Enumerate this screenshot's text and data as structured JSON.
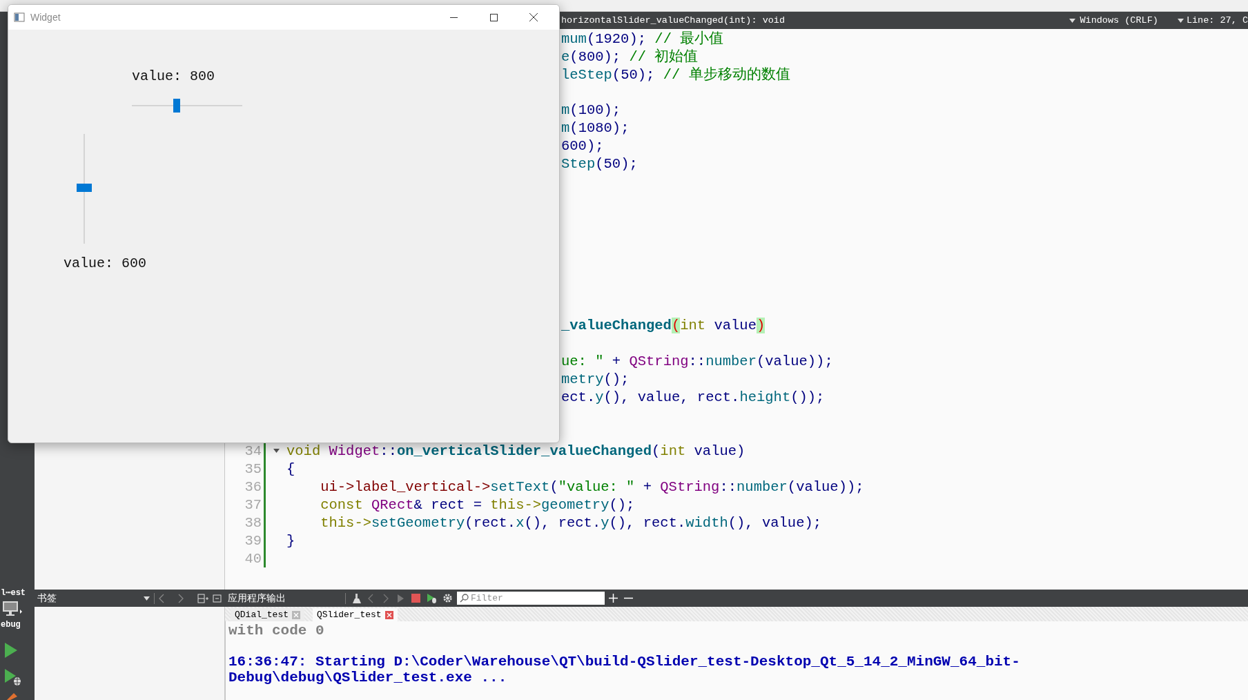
{
  "ide": {
    "mode_bar": {
      "project": "l⋯est",
      "build_config": "ebug"
    },
    "editor_toolbar": {
      "symbol": "horizontalSlider_valueChanged(int): void",
      "line_ending": "Windows (CRLF)",
      "position": "Line: 27, C"
    },
    "editor": {
      "lines": [
        {
          "kind": "partial",
          "tokens": [
            {
              "text": "mum",
              "kind": "fn"
            },
            {
              "text": "(",
              "kind": "plain"
            },
            {
              "text": "1920",
              "kind": "num"
            },
            {
              "text": "); ",
              "kind": "plain"
            },
            {
              "text": "// 最小值",
              "kind": "cmt"
            }
          ]
        },
        {
          "kind": "partial",
          "tokens": [
            {
              "text": "e",
              "kind": "fn"
            },
            {
              "text": "(",
              "kind": "plain"
            },
            {
              "text": "800",
              "kind": "num"
            },
            {
              "text": "); ",
              "kind": "plain"
            },
            {
              "text": "// 初始值",
              "kind": "cmt"
            }
          ]
        },
        {
          "kind": "partial",
          "tokens": [
            {
              "text": "leStep",
              "kind": "fn"
            },
            {
              "text": "(",
              "kind": "plain"
            },
            {
              "text": "50",
              "kind": "num"
            },
            {
              "text": "); ",
              "kind": "plain"
            },
            {
              "text": "// 单步移动的数值",
              "kind": "cmt"
            }
          ]
        },
        {
          "kind": "blank"
        },
        {
          "kind": "partial",
          "tokens": [
            {
              "text": "m",
              "kind": "fn"
            },
            {
              "text": "(",
              "kind": "plain"
            },
            {
              "text": "100",
              "kind": "num"
            },
            {
              "text": ");",
              "kind": "plain"
            }
          ]
        },
        {
          "kind": "partial",
          "tokens": [
            {
              "text": "m",
              "kind": "fn"
            },
            {
              "text": "(",
              "kind": "plain"
            },
            {
              "text": "1080",
              "kind": "num"
            },
            {
              "text": ");",
              "kind": "plain"
            }
          ]
        },
        {
          "kind": "partial",
          "tokens": [
            {
              "text": "600",
              "kind": "num"
            },
            {
              "text": ");",
              "kind": "plain"
            }
          ]
        },
        {
          "kind": "partial",
          "tokens": [
            {
              "text": "Step",
              "kind": "fn"
            },
            {
              "text": "(",
              "kind": "plain"
            },
            {
              "text": "50",
              "kind": "num"
            },
            {
              "text": ");",
              "kind": "plain"
            }
          ]
        },
        {
          "kind": "blank"
        },
        {
          "kind": "blank"
        },
        {
          "kind": "blank"
        },
        {
          "kind": "blank"
        },
        {
          "kind": "blank"
        },
        {
          "kind": "blank"
        },
        {
          "kind": "blank"
        },
        {
          "kind": "blank"
        },
        {
          "kind": "partial",
          "tokens": [
            {
              "text": "_valueChanged",
              "kind": "fnb"
            },
            {
              "text": "(",
              "kind": "match"
            },
            {
              "text": "int",
              "kind": "kw"
            },
            {
              "text": " value",
              "kind": "plain"
            },
            {
              "text": ")",
              "kind": "match"
            }
          ]
        },
        {
          "kind": "blank"
        },
        {
          "kind": "partial",
          "tokens": [
            {
              "text": "ue: ″",
              "kind": "str"
            },
            {
              "text": " + ",
              "kind": "plain"
            },
            {
              "text": "QString",
              "kind": "type"
            },
            {
              "text": "::",
              "kind": "plain"
            },
            {
              "text": "number",
              "kind": "fn"
            },
            {
              "text": "(value));",
              "kind": "plain"
            }
          ]
        },
        {
          "kind": "partial",
          "tokens": [
            {
              "text": "metry",
              "kind": "fn"
            },
            {
              "text": "();",
              "kind": "plain"
            }
          ]
        },
        {
          "kind": "partial",
          "tokens": [
            {
              "text": "ect.",
              "kind": "plain"
            },
            {
              "text": "y",
              "kind": "fn"
            },
            {
              "text": "(), value, rect.",
              "kind": "plain"
            },
            {
              "text": "height",
              "kind": "fn"
            },
            {
              "text": "());",
              "kind": "plain"
            }
          ]
        },
        {
          "kind": "blank"
        },
        {
          "kind": "blank"
        },
        {
          "kind": "code",
          "number": "34",
          "foldable": true,
          "tokens": [
            {
              "text": "void",
              "kind": "kw"
            },
            {
              "text": " Widget",
              "kind": "type"
            },
            {
              "text": "::",
              "kind": "plain"
            },
            {
              "text": "on_verticalSlider_valueChanged",
              "kind": "fnb"
            },
            {
              "text": "(",
              "kind": "plain"
            },
            {
              "text": "int",
              "kind": "kw"
            },
            {
              "text": " value)",
              "kind": "plain"
            }
          ]
        },
        {
          "kind": "code",
          "number": "35",
          "tokens": [
            {
              "text": "{",
              "kind": "plain"
            }
          ]
        },
        {
          "kind": "code",
          "number": "36",
          "tokens": [
            {
              "text": "    ui->label_vertical->",
              "kind": "member"
            },
            {
              "text": "setText",
              "kind": "fn"
            },
            {
              "text": "(",
              "kind": "plain"
            },
            {
              "text": "″value: ″",
              "kind": "str"
            },
            {
              "text": " + ",
              "kind": "plain"
            },
            {
              "text": "QString",
              "kind": "type"
            },
            {
              "text": "::",
              "kind": "plain"
            },
            {
              "text": "number",
              "kind": "fn"
            },
            {
              "text": "(value));",
              "kind": "plain"
            }
          ]
        },
        {
          "kind": "code",
          "number": "37",
          "tokens": [
            {
              "text": "    const",
              "kind": "kw"
            },
            {
              "text": " QRect",
              "kind": "type"
            },
            {
              "text": "& rect = ",
              "kind": "plain"
            },
            {
              "text": "this->",
              "kind": "kw"
            },
            {
              "text": "geometry",
              "kind": "fn"
            },
            {
              "text": "();",
              "kind": "plain"
            }
          ]
        },
        {
          "kind": "code",
          "number": "38",
          "tokens": [
            {
              "text": "    this->",
              "kind": "kw"
            },
            {
              "text": "setGeometry",
              "kind": "fn"
            },
            {
              "text": "(rect.",
              "kind": "plain"
            },
            {
              "text": "x",
              "kind": "fn"
            },
            {
              "text": "(), rect.",
              "kind": "plain"
            },
            {
              "text": "y",
              "kind": "fn"
            },
            {
              "text": "(), rect.",
              "kind": "plain"
            },
            {
              "text": "width",
              "kind": "fn"
            },
            {
              "text": "(), value);",
              "kind": "plain"
            }
          ]
        },
        {
          "kind": "code",
          "number": "39",
          "tokens": [
            {
              "text": "}",
              "kind": "plain"
            }
          ]
        },
        {
          "kind": "code",
          "number": "40"
        }
      ]
    },
    "bookmarks": {
      "title": "书签"
    },
    "output": {
      "title": "应用程序输出",
      "filter": {
        "placeholder": "Filter"
      },
      "tabs": [
        {
          "label": "QDial_test",
          "selected": false
        },
        {
          "label": "QSlider_test",
          "selected": true
        }
      ],
      "messages": [
        {
          "kind": "exit",
          "text": "with code 0"
        },
        {
          "kind": "start",
          "text": "16:36:47: Starting D:\\Coder\\Warehouse\\QT\\build-QSlider_test-Desktop_Qt_5_14_2_MinGW_64_bit-Debug\\debug\\QSlider_test.exe ..."
        }
      ]
    }
  },
  "widget_window": {
    "title": "Widget",
    "horizontal_label": "value: 800",
    "horizontal_slider": {
      "level": 0.4
    },
    "vertical_slider": {
      "level": 0.51
    },
    "vertical_label": "value: 600"
  }
}
